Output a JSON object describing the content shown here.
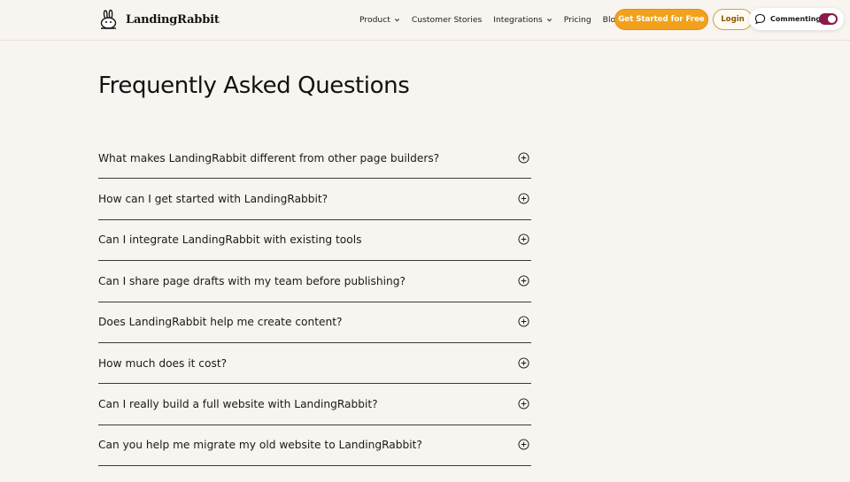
{
  "navbar": {
    "brand": "LandingRabbit",
    "logo_icon": "rabbit-logo-icon",
    "links": [
      {
        "label": "Product",
        "has_dropdown": true
      },
      {
        "label": "Customer Stories",
        "has_dropdown": false
      },
      {
        "label": "Integrations",
        "has_dropdown": true
      },
      {
        "label": "Pricing",
        "has_dropdown": false
      },
      {
        "label": "Blog",
        "has_dropdown": false
      }
    ],
    "cta_label": "Get Started for Free",
    "login_label": "Login"
  },
  "commenting": {
    "label": "Commenting",
    "enabled": true,
    "icon": "comment-bubble-icon"
  },
  "faq": {
    "title": "Frequently Asked Questions",
    "expand_icon": "plus-circle-icon",
    "items": [
      "What makes LandingRabbit different from other page builders?",
      "How can I get started with LandingRabbit?",
      "Can I integrate LandingRabbit with existing tools",
      "Can I share page drafts with my team before publishing?",
      "Does LandingRabbit help me create content?",
      "How much does it cost?",
      "Can I really build a full website with LandingRabbit?",
      "Can you help me migrate my old website to LandingRabbit?"
    ]
  },
  "colors": {
    "background": "#f8f4ef",
    "cta": "#f2a11c",
    "toggle": "#8b1a4a",
    "text": "#121212"
  }
}
